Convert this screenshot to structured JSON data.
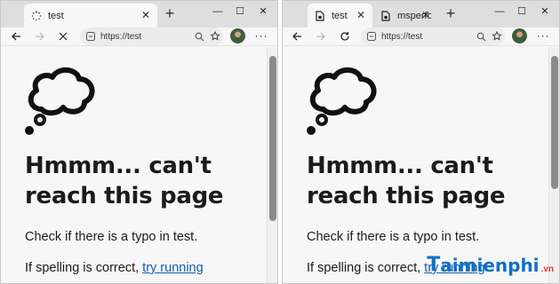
{
  "left_window": {
    "tabs": [
      {
        "label": "test",
        "icon": "loading-icon",
        "close": "✕"
      }
    ],
    "new_tab_label": "+",
    "window_controls": [
      "—",
      "☐",
      "✕"
    ],
    "address": {
      "url": "https://test"
    },
    "more_label": "···",
    "page": {
      "heading": "Hmmm... can't reach this page",
      "hint1": "Check if there is a typo in test.",
      "hint2_prefix": "If spelling is correct, ",
      "hint2_link": "try running"
    }
  },
  "right_window": {
    "tabs": [
      {
        "label": "test",
        "icon": "page-icon",
        "close": "✕"
      },
      {
        "label": "msperform",
        "icon": "page-icon",
        "close": "✕"
      }
    ],
    "new_tab_label": "+",
    "window_controls": [
      "—",
      "☐",
      "✕"
    ],
    "address": {
      "url": "https://test"
    },
    "more_label": "···",
    "page": {
      "heading": "Hmmm... can't reach this page",
      "hint1": "Check if there is a typo in test.",
      "hint2_prefix": "If spelling is correct, ",
      "hint2_link": "try running"
    }
  },
  "watermark": {
    "brand_t": "T",
    "brand_rest": "aimienphi",
    "tld": ".vn"
  },
  "colors": {
    "link": "#0f5fa6",
    "watermark": "#1170c4",
    "watermark_tld": "#e23a3a"
  }
}
